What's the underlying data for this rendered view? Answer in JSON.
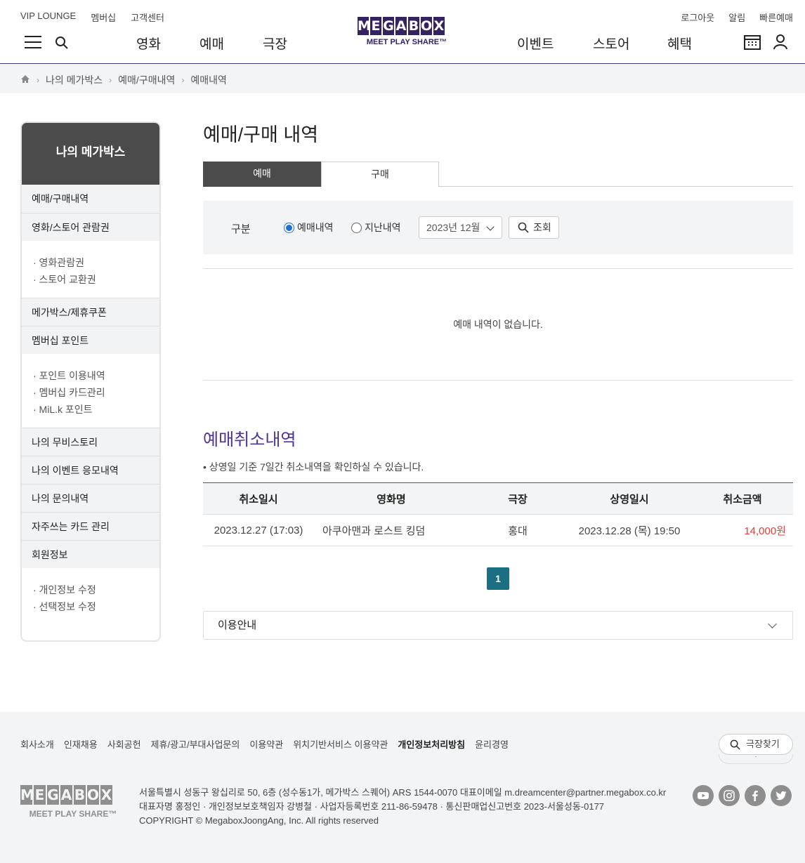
{
  "header": {
    "util_left": [
      "VIP LOUNGE",
      "멤버십",
      "고객센터"
    ],
    "util_right": [
      "로그아웃",
      "알림",
      "빠른예매"
    ],
    "gnb_left": [
      "영화",
      "예매",
      "극장"
    ],
    "gnb_right": [
      "이벤트",
      "스토어",
      "혜택"
    ],
    "logo_letters": [
      "M",
      "E",
      "G",
      "A",
      "B",
      "O",
      "X"
    ],
    "logo_tag": "MEET PLAY SHARE™"
  },
  "breadcrumb": [
    "나의 메가박스",
    "예매/구매내역",
    "예매내역"
  ],
  "sidebar": {
    "title": "나의 메가박스",
    "items": [
      {
        "label": "예매/구매내역",
        "sub": []
      },
      {
        "label": "영화/스토어 관람권",
        "sub": [
          "· 영화관람권",
          "· 스토어 교환권"
        ]
      },
      {
        "label": "메가박스/제휴쿠폰",
        "sub": []
      },
      {
        "label": "멤버십 포인트",
        "sub": [
          "· 포인트 이용내역",
          "· 멤버십 카드관리",
          "· MiL.k 포인트"
        ]
      },
      {
        "label": "나의 무비스토리",
        "sub": []
      },
      {
        "label": "나의 이벤트 응모내역",
        "sub": []
      },
      {
        "label": "나의 문의내역",
        "sub": []
      },
      {
        "label": "자주쓰는 카드 관리",
        "sub": []
      },
      {
        "label": "회원정보",
        "sub": [
          "· 개인정보 수정",
          "· 선택정보 수정"
        ]
      }
    ]
  },
  "main": {
    "title": "예매/구매 내역",
    "tabs": [
      "예매",
      "구매"
    ],
    "active_tab": "예매",
    "filter": {
      "label": "구분",
      "radio_1": "예매내역",
      "radio_2": "지난내역",
      "selected_radio": "예매내역",
      "month": "2023년 12월",
      "search_label": "조회"
    },
    "empty_message": "예매 내역이 없습니다.",
    "cancel": {
      "title": "예매취소내역",
      "note": "• 상영일 기준 7일간 취소내역을 확인하실 수 있습니다.",
      "columns": [
        "취소일시",
        "영화명",
        "극장",
        "상영일시",
        "취소금액"
      ],
      "rows": [
        {
          "cancel_date": "2023.12.27 (17:03)",
          "movie": "아쿠아맨과 로스트 킹덤",
          "theater": "홍대",
          "show_date": "2023.12.28 (목) 19:50",
          "amount": "14,000원"
        }
      ]
    },
    "page": "1",
    "guide_label": "이용안내"
  },
  "footer": {
    "links": [
      "회사소개",
      "인재채용",
      "사회공헌",
      "제휴/광고/부대사업문의",
      "이용약관",
      "위치기반서비스 이용약관",
      "개인정보처리방침",
      "윤리경영"
    ],
    "bold_link": "개인정보처리방침",
    "find_label": "극장찾기",
    "find_under": "·",
    "info_1": "서울특별시 성동구 왕십리로 50, 6층 (성수동1가, 메가박스 스퀘어) ARS 1544-0070 대표이메일 m.dreamcenter@partner.megabox.co.kr",
    "info_2": "대표자명 홍정인 · 개인정보보호책임자 강병철 · 사업자등록번호 211-86-59478 · 통신판매업신고번호 2023-서울성동-0177",
    "info_3": "COPYRIGHT © MegaboxJoongAng, Inc. All rights reserved",
    "logo_tag": "MEET PLAY SHARE™",
    "sns": [
      "youtube-icon",
      "instagram-icon",
      "facebook-icon",
      "twitter-icon"
    ]
  },
  "colors": {
    "brand": "#352263",
    "accent_purple": "#503396",
    "pager": "#1a6f83",
    "amount_red": "#e63e30"
  }
}
